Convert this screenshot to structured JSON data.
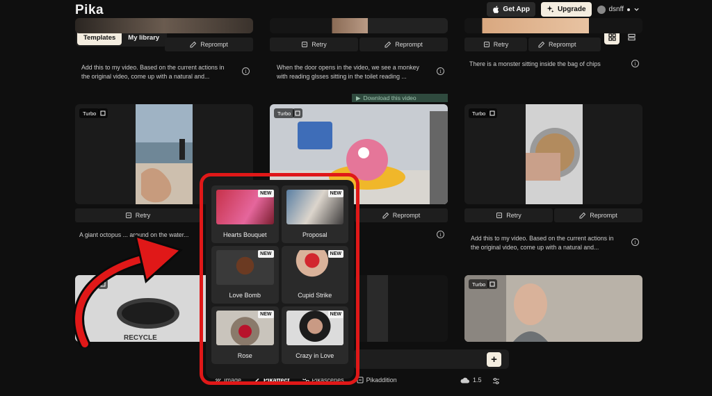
{
  "header": {
    "logo": "Pika",
    "get_app": "Get App",
    "upgrade": "Upgrade",
    "username": "dsnff"
  },
  "tabs": [
    {
      "label": "Templates",
      "active": true
    },
    {
      "label": "My library",
      "active": false
    }
  ],
  "actions": {
    "retry": "Retry",
    "reprompt": "Reprompt"
  },
  "badge": {
    "turbo": "Turbo"
  },
  "cards": {
    "row1": [
      {
        "prompt": "Add this to my video. Based on the current actions in the original video, come up with a natural and..."
      },
      {
        "prompt": "When the door opens in the video, we see a monkey with reading glsses sitting in the toilet reading ..."
      },
      {
        "prompt": "There is a monster sitting inside the bag of chips"
      }
    ],
    "row2": [
      {
        "prompt": "A giant octopus ... around on the water..."
      },
      {
        "overlay": "Download this video"
      },
      {
        "prompt": "Add this to my video. Based on the current actions in the original video, come up with a natural and..."
      }
    ]
  },
  "templates_popup": {
    "new_badge": "NEW",
    "items": [
      {
        "label": "Hearts Bouquet"
      },
      {
        "label": "Proposal"
      },
      {
        "label": "Love Bomb"
      },
      {
        "label": "Cupid Strike"
      },
      {
        "label": "Rose"
      },
      {
        "label": "Crazy in Love"
      }
    ]
  },
  "bottom_bar": {
    "modes": [
      {
        "label": "Image",
        "active": false
      },
      {
        "label": "Pikaffect",
        "active": true
      },
      {
        "label": "Pikascenes",
        "active": false
      },
      {
        "label": "Pikaddition",
        "active": false
      }
    ],
    "model_version": "1.5"
  },
  "colors": {
    "background": "#0f0f0f",
    "accent_cream": "#f4ede0",
    "highlight_red": "#e01818"
  }
}
